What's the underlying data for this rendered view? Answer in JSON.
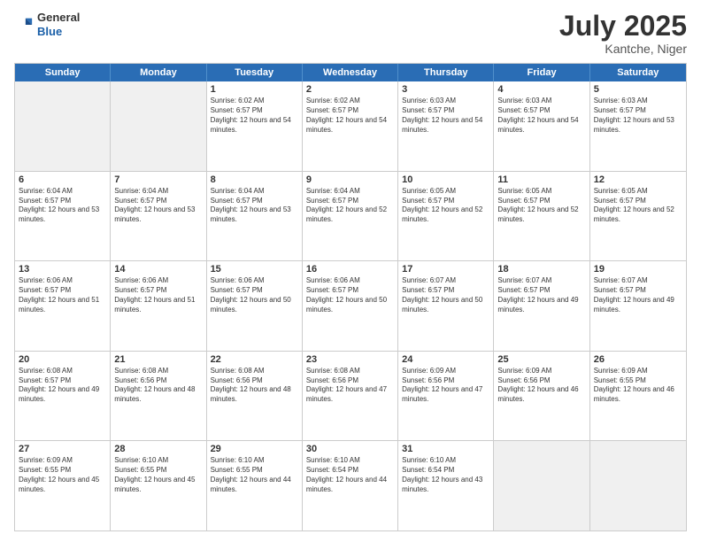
{
  "header": {
    "logo_line1": "General",
    "logo_line2": "Blue",
    "month": "July 2025",
    "location": "Kantche, Niger"
  },
  "days_of_week": [
    "Sunday",
    "Monday",
    "Tuesday",
    "Wednesday",
    "Thursday",
    "Friday",
    "Saturday"
  ],
  "weeks": [
    [
      {
        "day": "",
        "info": "",
        "shaded": true
      },
      {
        "day": "",
        "info": "",
        "shaded": true
      },
      {
        "day": "1",
        "info": "Sunrise: 6:02 AM\nSunset: 6:57 PM\nDaylight: 12 hours and 54 minutes."
      },
      {
        "day": "2",
        "info": "Sunrise: 6:02 AM\nSunset: 6:57 PM\nDaylight: 12 hours and 54 minutes."
      },
      {
        "day": "3",
        "info": "Sunrise: 6:03 AM\nSunset: 6:57 PM\nDaylight: 12 hours and 54 minutes."
      },
      {
        "day": "4",
        "info": "Sunrise: 6:03 AM\nSunset: 6:57 PM\nDaylight: 12 hours and 54 minutes."
      },
      {
        "day": "5",
        "info": "Sunrise: 6:03 AM\nSunset: 6:57 PM\nDaylight: 12 hours and 53 minutes."
      }
    ],
    [
      {
        "day": "6",
        "info": "Sunrise: 6:04 AM\nSunset: 6:57 PM\nDaylight: 12 hours and 53 minutes."
      },
      {
        "day": "7",
        "info": "Sunrise: 6:04 AM\nSunset: 6:57 PM\nDaylight: 12 hours and 53 minutes."
      },
      {
        "day": "8",
        "info": "Sunrise: 6:04 AM\nSunset: 6:57 PM\nDaylight: 12 hours and 53 minutes."
      },
      {
        "day": "9",
        "info": "Sunrise: 6:04 AM\nSunset: 6:57 PM\nDaylight: 12 hours and 52 minutes."
      },
      {
        "day": "10",
        "info": "Sunrise: 6:05 AM\nSunset: 6:57 PM\nDaylight: 12 hours and 52 minutes."
      },
      {
        "day": "11",
        "info": "Sunrise: 6:05 AM\nSunset: 6:57 PM\nDaylight: 12 hours and 52 minutes."
      },
      {
        "day": "12",
        "info": "Sunrise: 6:05 AM\nSunset: 6:57 PM\nDaylight: 12 hours and 52 minutes."
      }
    ],
    [
      {
        "day": "13",
        "info": "Sunrise: 6:06 AM\nSunset: 6:57 PM\nDaylight: 12 hours and 51 minutes."
      },
      {
        "day": "14",
        "info": "Sunrise: 6:06 AM\nSunset: 6:57 PM\nDaylight: 12 hours and 51 minutes."
      },
      {
        "day": "15",
        "info": "Sunrise: 6:06 AM\nSunset: 6:57 PM\nDaylight: 12 hours and 50 minutes."
      },
      {
        "day": "16",
        "info": "Sunrise: 6:06 AM\nSunset: 6:57 PM\nDaylight: 12 hours and 50 minutes."
      },
      {
        "day": "17",
        "info": "Sunrise: 6:07 AM\nSunset: 6:57 PM\nDaylight: 12 hours and 50 minutes."
      },
      {
        "day": "18",
        "info": "Sunrise: 6:07 AM\nSunset: 6:57 PM\nDaylight: 12 hours and 49 minutes."
      },
      {
        "day": "19",
        "info": "Sunrise: 6:07 AM\nSunset: 6:57 PM\nDaylight: 12 hours and 49 minutes."
      }
    ],
    [
      {
        "day": "20",
        "info": "Sunrise: 6:08 AM\nSunset: 6:57 PM\nDaylight: 12 hours and 49 minutes."
      },
      {
        "day": "21",
        "info": "Sunrise: 6:08 AM\nSunset: 6:56 PM\nDaylight: 12 hours and 48 minutes."
      },
      {
        "day": "22",
        "info": "Sunrise: 6:08 AM\nSunset: 6:56 PM\nDaylight: 12 hours and 48 minutes."
      },
      {
        "day": "23",
        "info": "Sunrise: 6:08 AM\nSunset: 6:56 PM\nDaylight: 12 hours and 47 minutes."
      },
      {
        "day": "24",
        "info": "Sunrise: 6:09 AM\nSunset: 6:56 PM\nDaylight: 12 hours and 47 minutes."
      },
      {
        "day": "25",
        "info": "Sunrise: 6:09 AM\nSunset: 6:56 PM\nDaylight: 12 hours and 46 minutes."
      },
      {
        "day": "26",
        "info": "Sunrise: 6:09 AM\nSunset: 6:55 PM\nDaylight: 12 hours and 46 minutes."
      }
    ],
    [
      {
        "day": "27",
        "info": "Sunrise: 6:09 AM\nSunset: 6:55 PM\nDaylight: 12 hours and 45 minutes."
      },
      {
        "day": "28",
        "info": "Sunrise: 6:10 AM\nSunset: 6:55 PM\nDaylight: 12 hours and 45 minutes."
      },
      {
        "day": "29",
        "info": "Sunrise: 6:10 AM\nSunset: 6:55 PM\nDaylight: 12 hours and 44 minutes."
      },
      {
        "day": "30",
        "info": "Sunrise: 6:10 AM\nSunset: 6:54 PM\nDaylight: 12 hours and 44 minutes."
      },
      {
        "day": "31",
        "info": "Sunrise: 6:10 AM\nSunset: 6:54 PM\nDaylight: 12 hours and 43 minutes."
      },
      {
        "day": "",
        "info": "",
        "shaded": true
      },
      {
        "day": "",
        "info": "",
        "shaded": true
      }
    ]
  ]
}
